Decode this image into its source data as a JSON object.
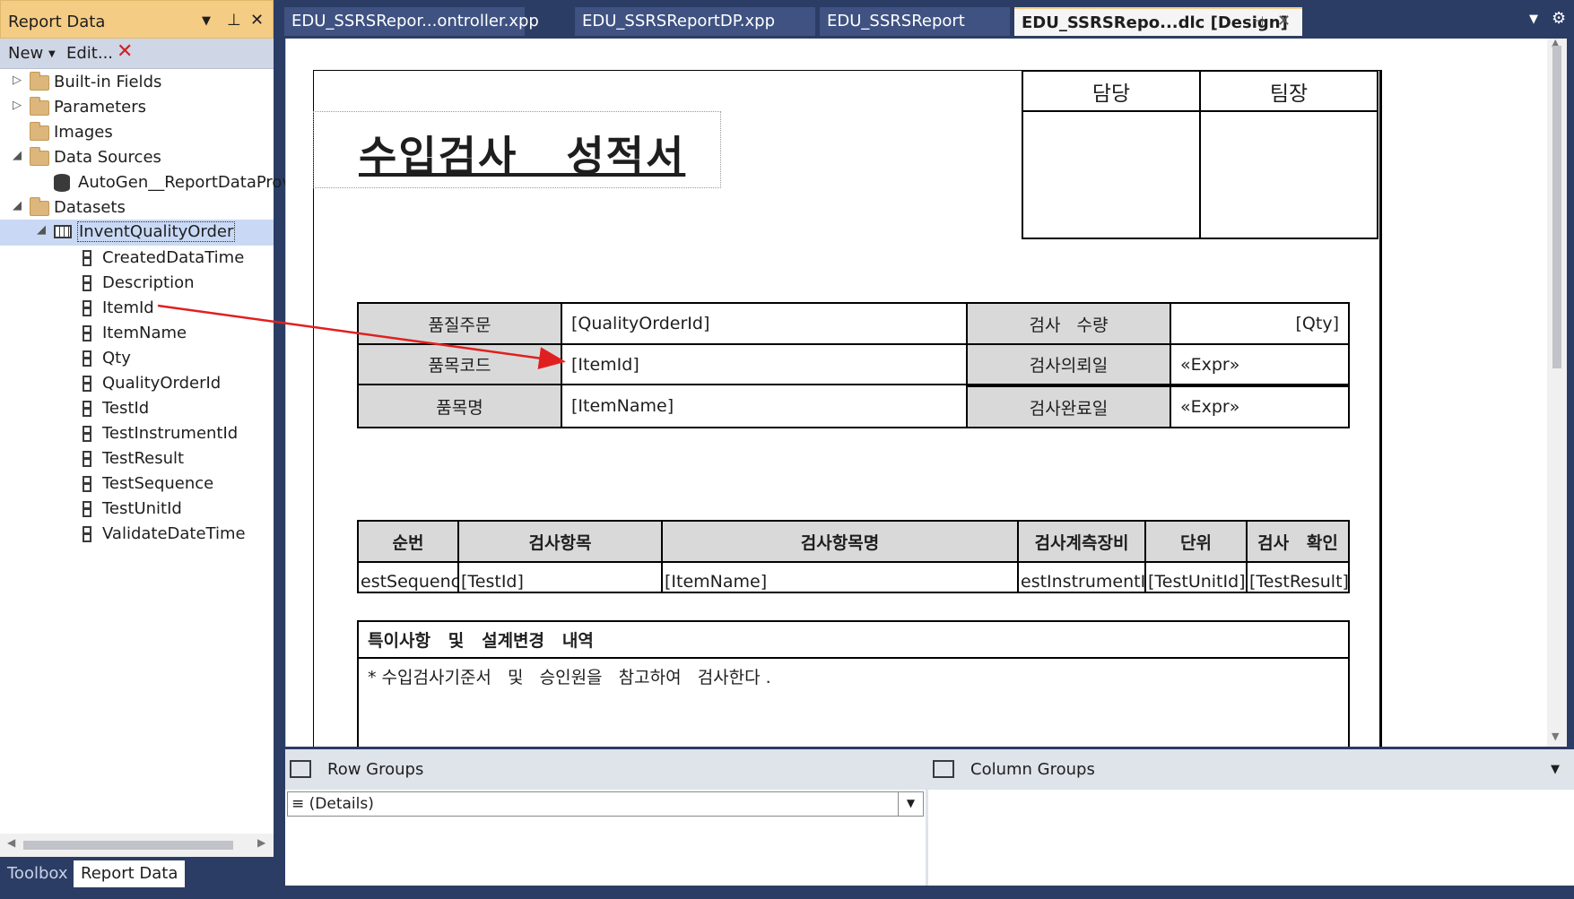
{
  "report_data_pane": {
    "title": "Report Data",
    "toolbar": {
      "new_label": "New",
      "edit_label": "Edit..."
    },
    "tree": {
      "builtin_fields": "Built-in Fields",
      "parameters": "Parameters",
      "images": "Images",
      "data_sources": "Data Sources",
      "data_source_item": "AutoGen__ReportDataProvi",
      "datasets": "Datasets",
      "dataset": "InventQualityOrder",
      "fields": [
        "CreatedDataTime",
        "Description",
        "ItemId",
        "ItemName",
        "Qty",
        "QualityOrderId",
        "TestId",
        "TestInstrumentId",
        "TestResult",
        "TestSequence",
        "TestUnitId",
        "ValidateDateTime"
      ]
    },
    "bottom_tabs": [
      "Toolbox",
      "Report Data"
    ]
  },
  "document_tabs": [
    "EDU_SSRSRepor...ontroller.xpp",
    "EDU_SSRSReportDP.xpp",
    "EDU_SSRSReport",
    "EDU_SSRSRepo...dlc [Design]"
  ],
  "report": {
    "title": "수입검사   성적서",
    "approval": {
      "col1": "담당",
      "col2": "팀장"
    },
    "info": {
      "r1": {
        "label": "품질주문",
        "value": "[QualityOrderId]",
        "label2": "검사   수량",
        "value2": "[Qty]"
      },
      "r2": {
        "label": "품목코드",
        "value": "[ItemId]",
        "label2": "검사의뢰일",
        "value2": "«Expr»"
      },
      "r3": {
        "label": "품목명",
        "value": "[ItemName]",
        "label2": "검사완료일",
        "value2": "«Expr»"
      }
    },
    "detail_headers": [
      "순번",
      "검사항목",
      "검사항목명",
      "검사계측장비",
      "단위",
      "검사   확인"
    ],
    "detail_values": [
      "estSequenc",
      "[TestId]",
      "[ItemName]",
      "estInstrumentI",
      "[TestUnitId]",
      "[TestResult]"
    ],
    "remarks": {
      "header": "특이사항   및   설계변경   내역",
      "text": "* 수입검사기준서   및   승인원을   참고하여   검사한다 ."
    }
  },
  "groups_pane": {
    "row_groups_label": "Row Groups",
    "column_groups_label": "Column Groups",
    "row_group_value": "≡ (Details)"
  },
  "colors": {
    "accent": "#f5cc84",
    "chrome": "#2b3d64",
    "selection": "#c9d9f5",
    "arrow": "#e02020"
  }
}
